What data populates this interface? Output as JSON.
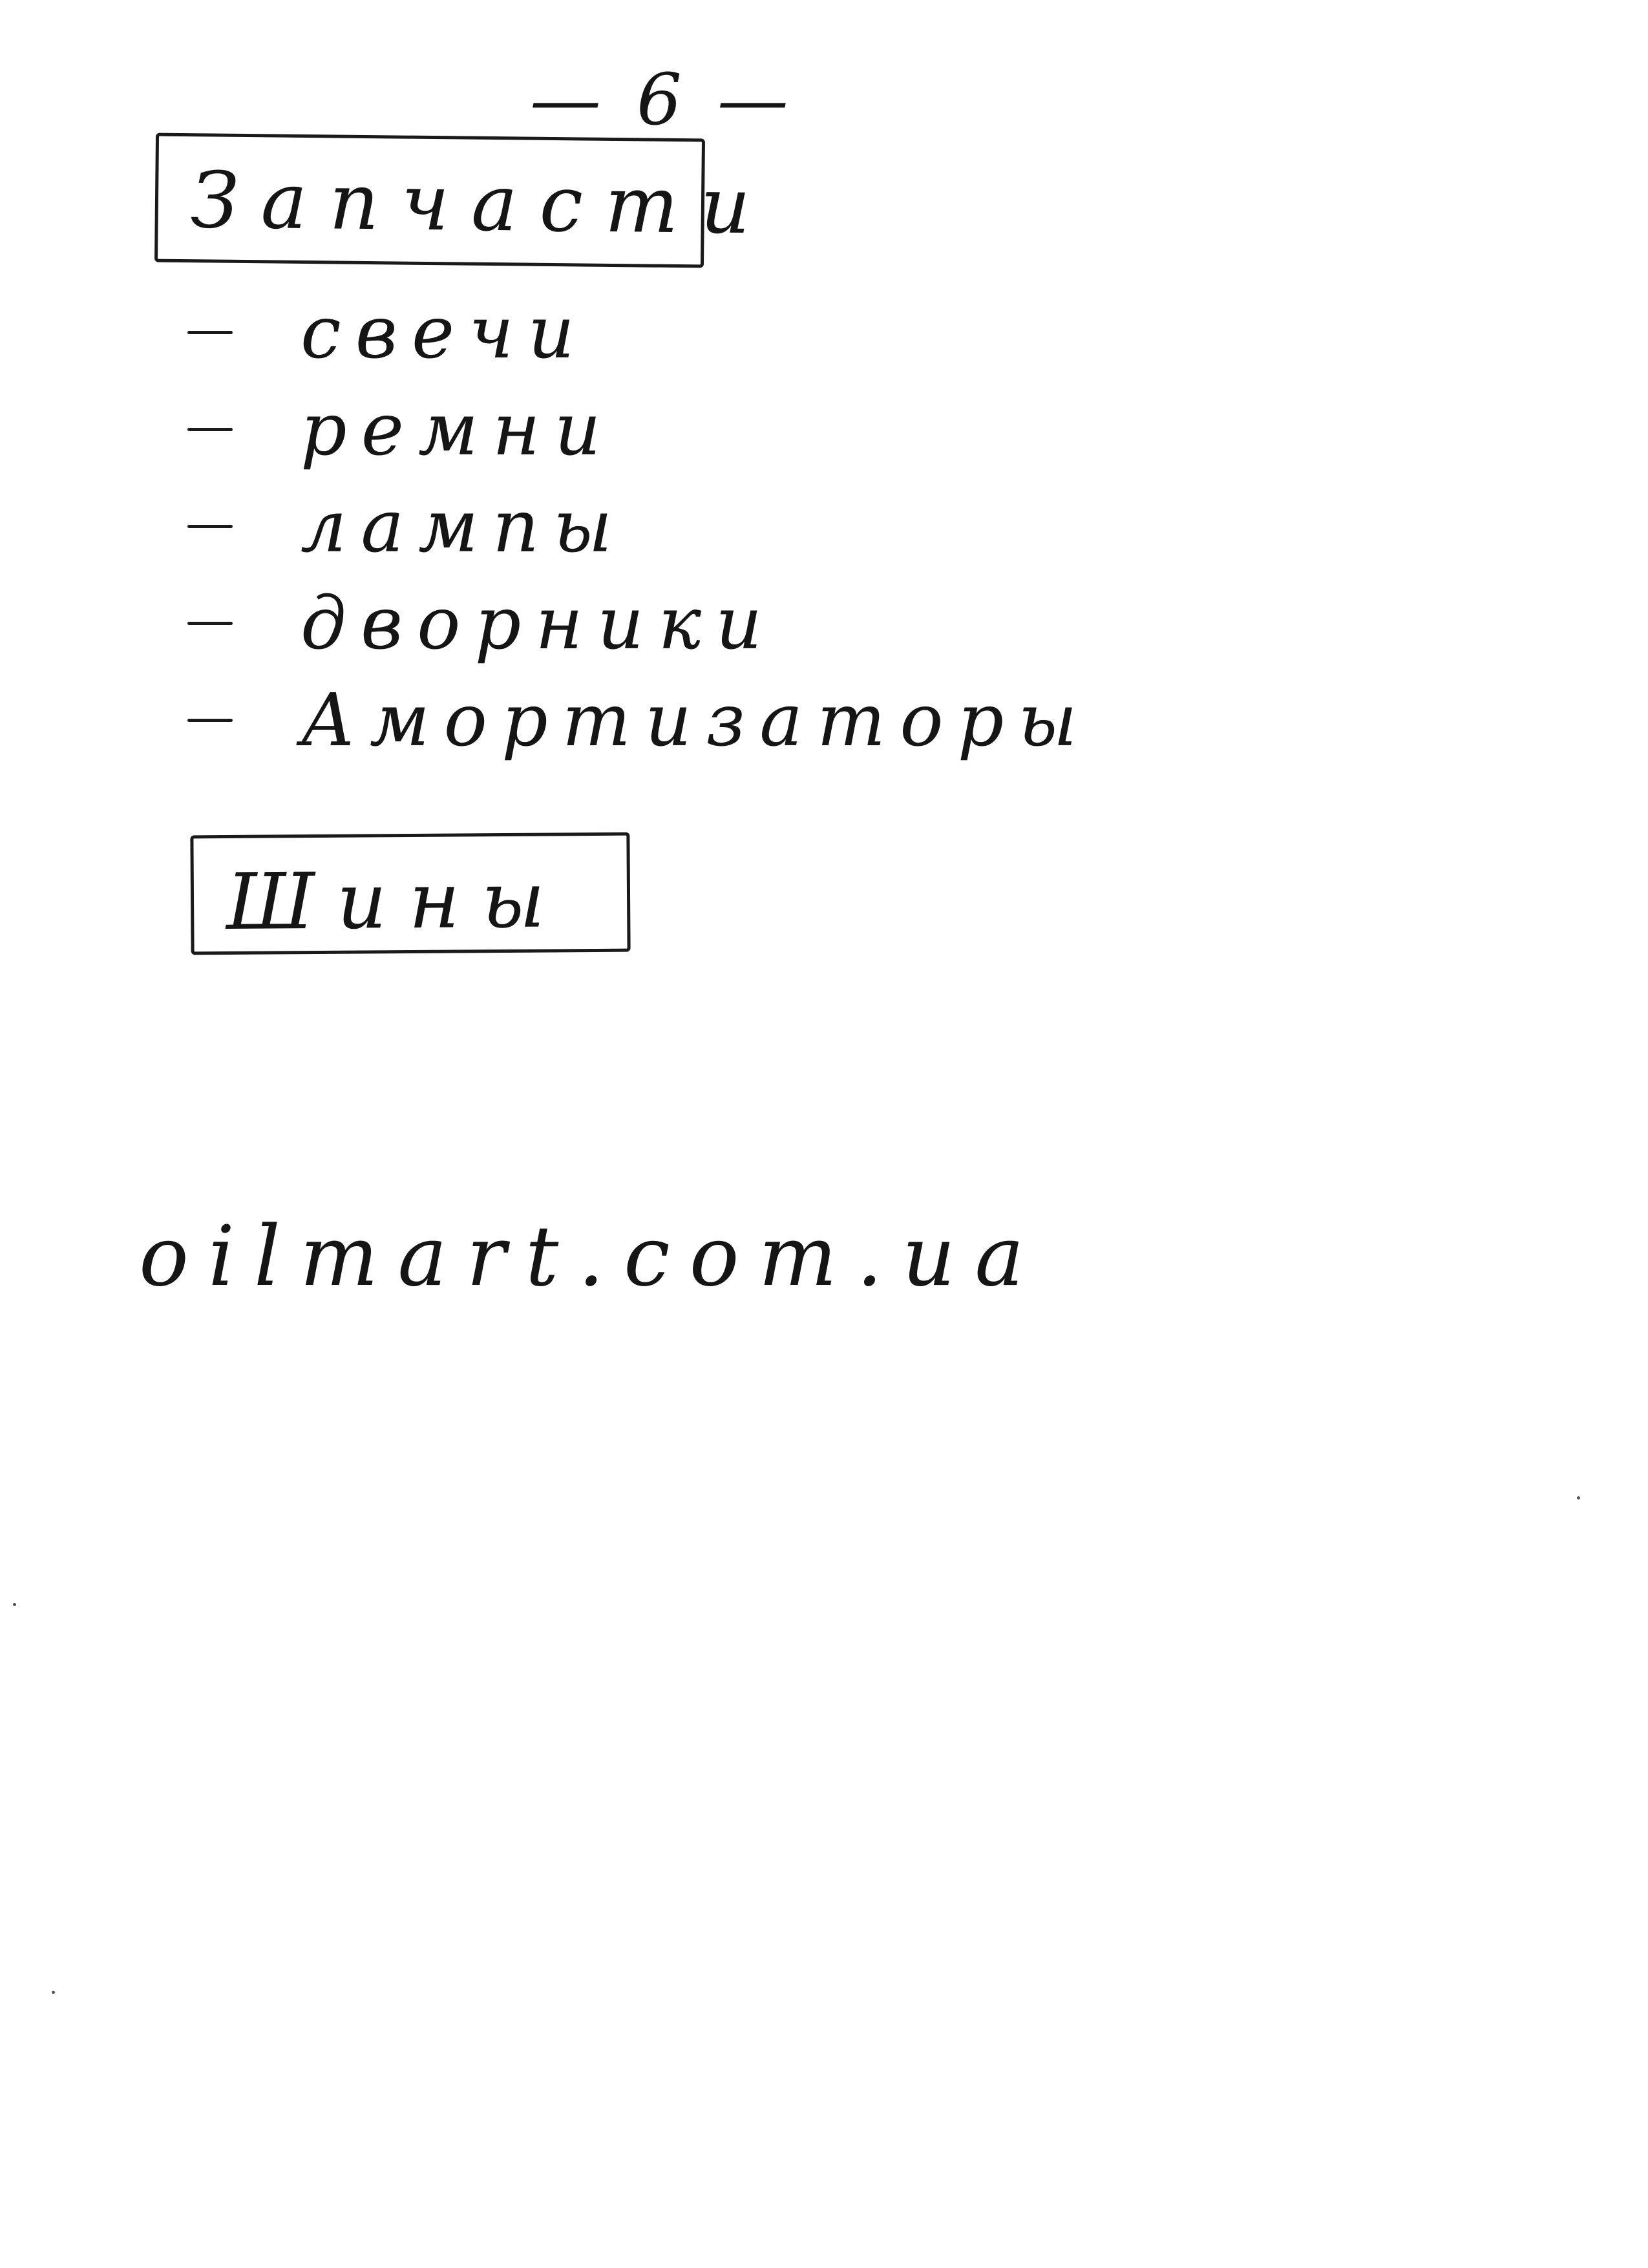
{
  "page": {
    "page_number": "— 6 —"
  },
  "sections": [
    {
      "title": "Запчасти",
      "items": [
        "свечи",
        "ремни",
        "лампы",
        "дворники",
        "Амортизаторы"
      ]
    },
    {
      "title": "Шины",
      "items": []
    }
  ],
  "footer": {
    "website": "oilmart.com.ua"
  }
}
